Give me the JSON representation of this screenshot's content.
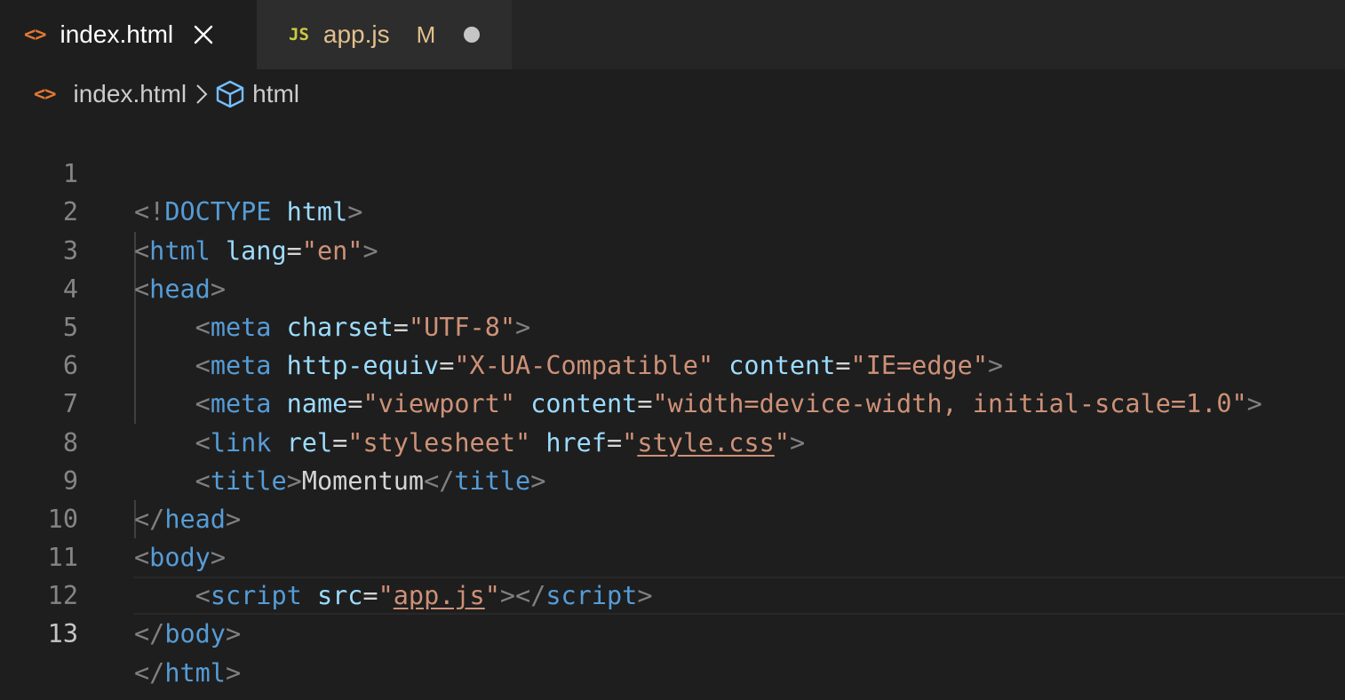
{
  "tabs": [
    {
      "icon": "<>",
      "label": "index.html",
      "active": true
    },
    {
      "icon": "JS",
      "label": "app.js",
      "status": "M",
      "dirty": true
    }
  ],
  "breadcrumb": {
    "file_icon": "<>",
    "file": "index.html",
    "symbol": "html"
  },
  "editor": {
    "current_line": 13,
    "line_numbers": [
      "1",
      "2",
      "3",
      "4",
      "5",
      "6",
      "7",
      "8",
      "9",
      "10",
      "11",
      "12",
      "13"
    ]
  },
  "code": {
    "l1": {
      "open": "<!",
      "tag": "DOCTYPE",
      "attr": "html",
      "close": ">"
    },
    "l2": {
      "open": "<",
      "tag": "html",
      "attr": "lang",
      "eq": "=",
      "val": "\"en\"",
      "close": ">"
    },
    "l3": {
      "open": "<",
      "tag": "head",
      "close": ">"
    },
    "l4": {
      "indent": "    ",
      "open": "<",
      "tag": "meta",
      "attr": "charset",
      "eq": "=",
      "val": "\"UTF-8\"",
      "close": ">"
    },
    "l5": {
      "indent": "    ",
      "open": "<",
      "tag": "meta",
      "attr1": "http-equiv",
      "eq1": "=",
      "val1": "\"X-UA-Compatible\"",
      "attr2": "content",
      "eq2": "=",
      "val2": "\"IE=edge\"",
      "close": ">"
    },
    "l6": {
      "indent": "    ",
      "open": "<",
      "tag": "meta",
      "attr1": "name",
      "eq1": "=",
      "val1": "\"viewport\"",
      "attr2": "content",
      "eq2": "=",
      "val2": "\"width=device-width, initial-scale=1.0\"",
      "close": ">"
    },
    "l7": {
      "indent": "    ",
      "open": "<",
      "tag": "link",
      "attr1": "rel",
      "eq1": "=",
      "val1": "\"stylesheet\"",
      "attr2": "href",
      "eq2": "=",
      "q_open": "\"",
      "link": "style.css",
      "q_close": "\"",
      "close": ">"
    },
    "l8": {
      "indent": "    ",
      "open": "<",
      "tag": "title",
      "mid": ">",
      "text": "Momentum",
      "open2": "</",
      "tag2": "title",
      "close": ">"
    },
    "l9": {
      "open": "</",
      "tag": "head",
      "close": ">"
    },
    "l10": {
      "open": "<",
      "tag": "body",
      "close": ">"
    },
    "l11": {
      "indent": "    ",
      "open": "<",
      "tag": "script",
      "attr": "src",
      "eq": "=",
      "q_open": "\"",
      "link": "app.js",
      "q_close": "\"",
      "mid": "></",
      "tag2": "script",
      "close": ">"
    },
    "l12": {
      "open": "</",
      "tag": "body",
      "close": ">"
    },
    "l13": {
      "open": "</",
      "tag": "html",
      "close": ">"
    }
  },
  "colors": {
    "background": "#1e1e1e",
    "tag": "#569cd6",
    "attribute": "#9cdcfe",
    "string": "#ce9178",
    "punctuation": "#808080",
    "modified": "#e2c08d",
    "html_icon": "#e37933",
    "js_icon": "#cbcb41"
  }
}
